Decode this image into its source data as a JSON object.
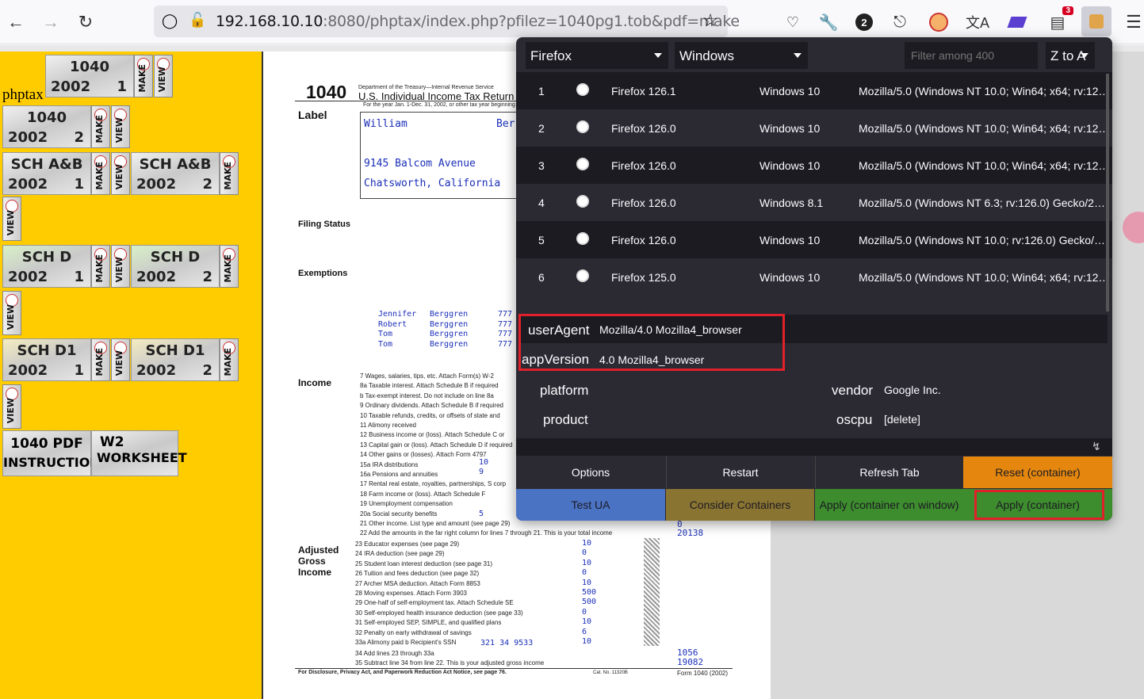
{
  "browser": {
    "url_host": "192.168.10.10",
    "url_rest": ":8080/phptax/index.php?pfilez=1040pg1.tob&pdf=make",
    "notification_badge": "2",
    "extension_badge": "3"
  },
  "left": {
    "phptax_label": "phptax",
    "tiles": [
      {
        "t1": "1040",
        "t2": "2002",
        "t3": "1"
      },
      {
        "t1": "1040",
        "t2": "2002",
        "t3": "2"
      },
      {
        "t1": "SCH A&B",
        "t2": "2002",
        "t3": "1"
      },
      {
        "t1": "SCH A&B",
        "t2": "2002",
        "t3": "2"
      },
      {
        "t1": "SCH D",
        "t2": "2002",
        "t3": "1"
      },
      {
        "t1": "SCH D",
        "t2": "2002",
        "t3": "2"
      },
      {
        "t1": "SCH D1",
        "t2": "2002",
        "t3": "1"
      },
      {
        "t1": "SCH D1",
        "t2": "2002",
        "t3": "2"
      }
    ],
    "make_label": "MAKE",
    "view_label": "VIEW",
    "instructions_1": "1040 PDF",
    "instructions_2": "INSTRUCTIONS",
    "worksheet_1": "W2",
    "worksheet_2": "WORKSHEET"
  },
  "form": {
    "form_no": "1040",
    "dept": "Department of the Treasury—Internal Revenue Service",
    "title": "U.S. Individual Income Tax Return",
    "year_line": "For the year Jan. 1-Dec. 31, 2002, or other tax year beginning",
    "label": "Label",
    "first_name": "William",
    "last_name": "Ber",
    "address": "9145 Balcom Avenue",
    "city": "Chatsworth, California",
    "filing_status": "Filing Status",
    "exemptions": "Exemptions",
    "income": "Income",
    "agi_1": "Adjusted",
    "agi_2": "Gross",
    "agi_3": "Income",
    "dependents": [
      {
        "first": "Jennifer",
        "last": "Berggren",
        "ssn": "777"
      },
      {
        "first": "Robert",
        "last": "Berggren",
        "ssn": "777"
      },
      {
        "first": "Tom",
        "last": "Berggren",
        "ssn": "777"
      },
      {
        "first": "Tom",
        "last": "Berggren",
        "ssn": "777"
      }
    ],
    "lines": [
      "7   Wages, salaries, tips, etc. Attach Form(s) W-2",
      "8a  Taxable interest. Attach Schedule B if required",
      "b   Tax-exempt interest. Do not include on line 8a",
      "9   Ordinary dividends. Attach Schedule B if required",
      "10  Taxable refunds, credits, or offsets of state and",
      "11  Alimony received",
      "12  Business income or (loss). Attach Schedule C or",
      "13  Capital gain or (loss). Attach Schedule D if required",
      "14  Other gains or (losses). Attach Form 4797",
      "15a IRA distributions",
      "16a Pensions and annuities",
      "17  Rental real estate, royalties, partnerships, S corp",
      "18  Farm income or (loss). Attach Schedule F",
      "19  Unemployment compensation",
      "20a Social security benefits",
      "21  Other income. List type and amount (see page 29)",
      "22  Add the amounts in the far right column for lines 7 through 21. This is your total income"
    ],
    "agi_lines": [
      {
        "text": "23  Educator expenses (see page 29)",
        "val": "10"
      },
      {
        "text": "24  IRA deduction (see page 29)",
        "val": "0"
      },
      {
        "text": "25  Student loan interest deduction (see page 31)",
        "val": "10"
      },
      {
        "text": "26  Tuition and fees deduction (see page 32)",
        "val": "0"
      },
      {
        "text": "27  Archer MSA deduction. Attach Form 8853",
        "val": "10"
      },
      {
        "text": "28  Moving expenses. Attach Form 3903",
        "val": "500"
      },
      {
        "text": "29  One-half of self-employment tax. Attach Schedule SE",
        "val": "500"
      },
      {
        "text": "30  Self-employed health insurance deduction (see page 33)",
        "val": "0"
      },
      {
        "text": "31  Self-employed SEP, SIMPLE, and qualified plans",
        "val": "10"
      },
      {
        "text": "32  Penalty on early withdrawal of savings",
        "val": "6"
      },
      {
        "text": "33a Alimony paid   b Recipient's SSN",
        "val": "10"
      }
    ],
    "line33_ssn": "321 34 9533",
    "line21_val": "0",
    "line22_val": "20138",
    "line34": "34  Add lines 23 through 33a",
    "line34_val": "1056",
    "line35": "35  Subtract line 34 from line 22. This is your adjusted gross income",
    "line35_val": "19082",
    "line15a_val": "10",
    "line16a_val": "9",
    "line20a_val": "5",
    "footer": "For Disclosure, Privacy Act, and Paperwork Reduction Act Notice, see page 76.",
    "cat_no": "Cat. No. 11320B",
    "footer_form": "Form 1040 (2002)"
  },
  "popup": {
    "browser_select": "Firefox",
    "os_select": "Windows",
    "filter_placeholder": "Filter among 400",
    "sort_select": "Z to A",
    "rows": [
      {
        "n": "1",
        "browser": "Firefox 126.1",
        "os": "Windows 10",
        "ua": "Mozilla/5.0 (Windows NT 10.0; Win64; x64; rv:12…"
      },
      {
        "n": "2",
        "browser": "Firefox 126.0",
        "os": "Windows 10",
        "ua": "Mozilla/5.0 (Windows NT 10.0; Win64; x64; rv:12…"
      },
      {
        "n": "3",
        "browser": "Firefox 126.0",
        "os": "Windows 10",
        "ua": "Mozilla/5.0 (Windows NT 10.0; Win64; x64; rv:12…"
      },
      {
        "n": "4",
        "browser": "Firefox 126.0",
        "os": "Windows 8.1",
        "ua": "Mozilla/5.0 (Windows NT 6.3; rv:126.0) Gecko/2…"
      },
      {
        "n": "5",
        "browser": "Firefox 126.0",
        "os": "Windows 10",
        "ua": "Mozilla/5.0 (Windows NT 10.0; rv:126.0) Gecko/…"
      },
      {
        "n": "6",
        "browser": "Firefox 125.0",
        "os": "Windows 10",
        "ua": "Mozilla/5.0 (Windows NT 10.0; Win64; x64; rv:12…"
      }
    ],
    "useragent_label": "userAgent",
    "useragent_value": "Mozilla/4.0 Mozilla4_browser",
    "appversion_label": "appVersion",
    "appversion_value": "4.0 Mozilla4_browser",
    "platform_label": "platform",
    "vendor_label": "vendor",
    "vendor_value": "Google Inc.",
    "product_label": "product",
    "oscpu_label": "oscpu",
    "oscpu_value": "[delete]",
    "buttons": {
      "options": "Options",
      "restart": "Restart",
      "refresh": "Refresh Tab",
      "reset": "Reset (container)",
      "test": "Test UA",
      "consider": "Consider Containers",
      "apply_window": "Apply (container on window)",
      "apply": "Apply (container)"
    },
    "colors": {
      "reset": "#e5870f",
      "test": "#4b73c4",
      "consider": "#8a7432",
      "apply": "#3d8c2e",
      "highlight": "#e0202a"
    }
  }
}
